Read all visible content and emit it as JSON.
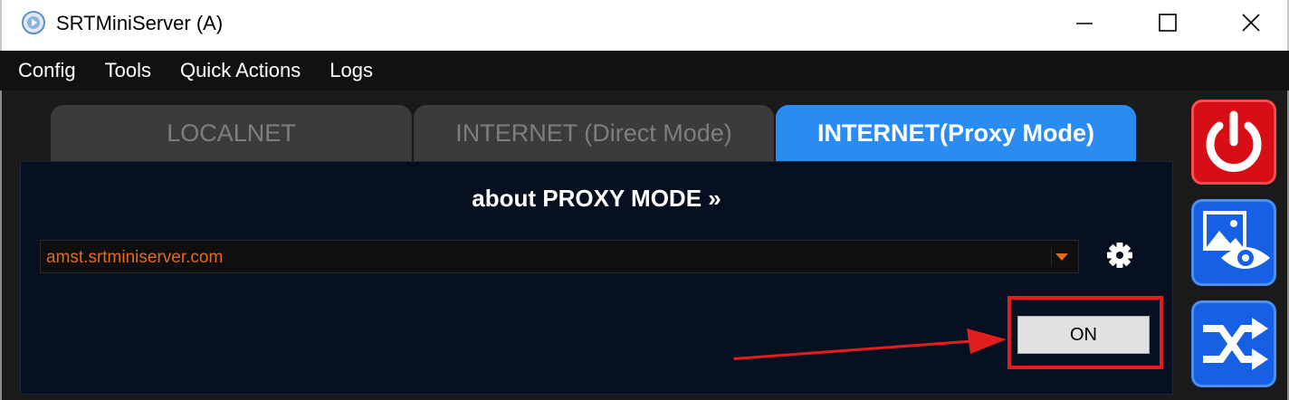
{
  "window": {
    "title": "SRTMiniServer (A)"
  },
  "menu": {
    "items": [
      "Config",
      "Tools",
      "Quick Actions",
      "Logs"
    ]
  },
  "tabs": [
    {
      "label": "LOCALNET",
      "active": false
    },
    {
      "label": "INTERNET (Direct Mode)",
      "active": false
    },
    {
      "label": "INTERNET(Proxy Mode)",
      "active": true
    }
  ],
  "panel": {
    "about_link": "about PROXY MODE »",
    "server_select": {
      "value": "amst.srtminiserver.com"
    },
    "on_button_label": "ON"
  },
  "sidebar": {
    "buttons": [
      {
        "name": "power",
        "icon": "power-icon",
        "color": "#d80e16"
      },
      {
        "name": "preview",
        "icon": "image-eye-icon",
        "color": "#1560e5"
      },
      {
        "name": "shuffle",
        "icon": "shuffle-icon",
        "color": "#1560e5"
      }
    ]
  },
  "colors": {
    "accent": "#2a8cf0",
    "server_text": "#e36a1c",
    "highlight": "#e21d1d"
  }
}
